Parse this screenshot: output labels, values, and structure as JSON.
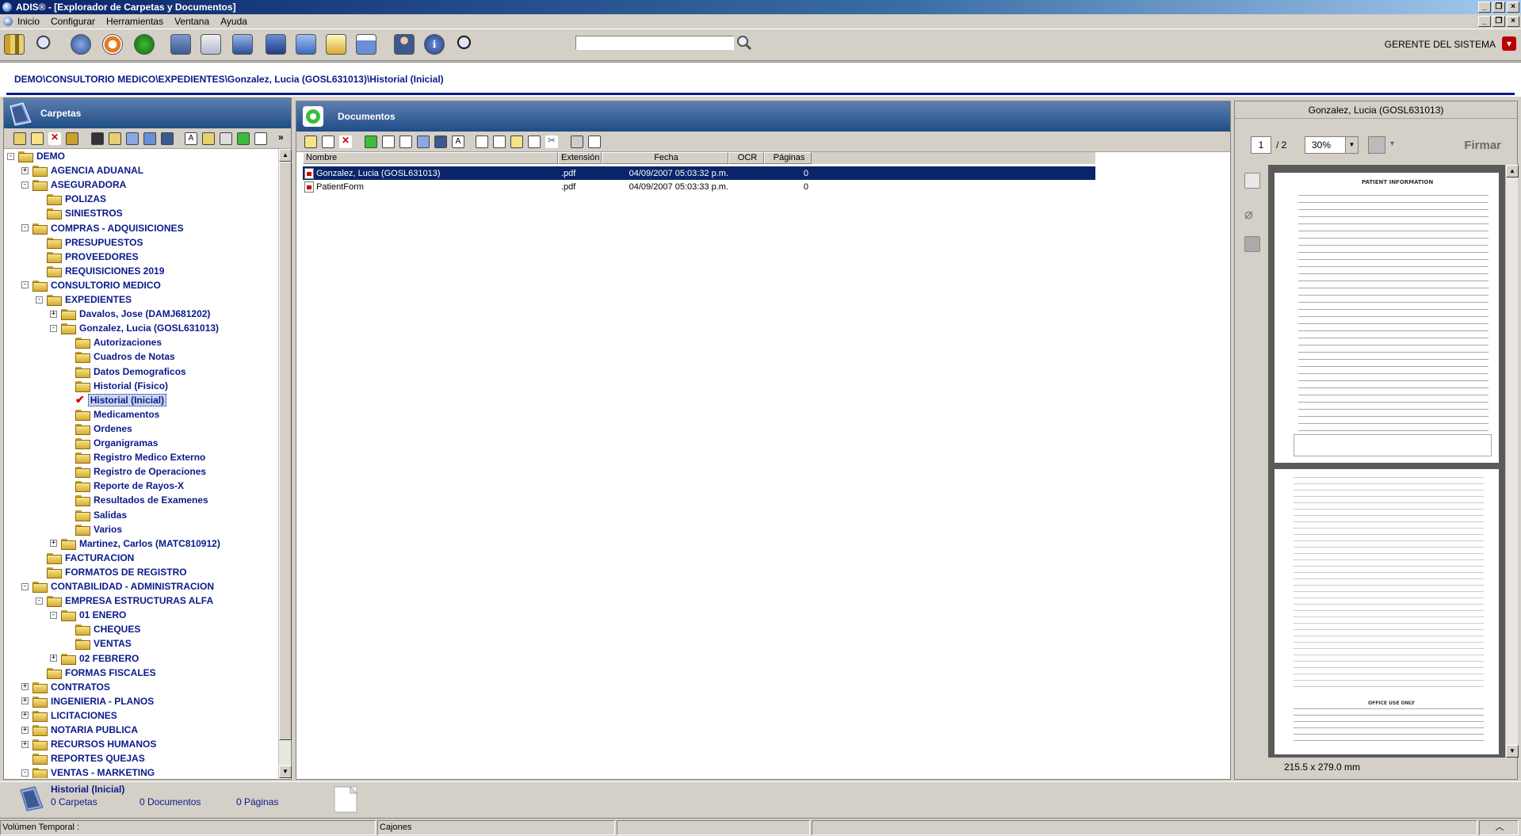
{
  "window": {
    "title": "ADIS® - [Explorador de Carpetas y Documentos]"
  },
  "menu": [
    "Inicio",
    "Configurar",
    "Herramientas",
    "Ventana",
    "Ayuda"
  ],
  "toolbar": {
    "search_value": "",
    "user": "GERENTE DEL SISTEMA"
  },
  "path": "DEMO\\CONSULTORIO MEDICO\\EXPEDIENTES\\Gonzalez, Lucia (GOSL631013)\\Historial (Inicial)",
  "folders_panel": {
    "title": "Carpetas",
    "tree": [
      {
        "label": "DEMO",
        "level": 0,
        "exp": "-"
      },
      {
        "label": "AGENCIA ADUANAL",
        "level": 1,
        "exp": "+"
      },
      {
        "label": "ASEGURADORA",
        "level": 1,
        "exp": "-"
      },
      {
        "label": "POLIZAS",
        "level": 2,
        "exp": ""
      },
      {
        "label": "SINIESTROS",
        "level": 2,
        "exp": ""
      },
      {
        "label": "COMPRAS - ADQUISICIONES",
        "level": 1,
        "exp": "-"
      },
      {
        "label": "PRESUPUESTOS",
        "level": 2,
        "exp": ""
      },
      {
        "label": "PROVEEDORES",
        "level": 2,
        "exp": ""
      },
      {
        "label": "REQUISICIONES 2019",
        "level": 2,
        "exp": ""
      },
      {
        "label": "CONSULTORIO MEDICO",
        "level": 1,
        "exp": "-"
      },
      {
        "label": "EXPEDIENTES",
        "level": 2,
        "exp": "-"
      },
      {
        "label": "Davalos, Jose (DAMJ681202)",
        "level": 3,
        "exp": "+"
      },
      {
        "label": "Gonzalez, Lucia (GOSL631013)",
        "level": 3,
        "exp": "-"
      },
      {
        "label": "Autorizaciones",
        "level": 4,
        "exp": ""
      },
      {
        "label": "Cuadros de Notas",
        "level": 4,
        "exp": ""
      },
      {
        "label": "Datos Demograficos",
        "level": 4,
        "exp": ""
      },
      {
        "label": "Historial (Fisico)",
        "level": 4,
        "exp": ""
      },
      {
        "label": "Historial (Inicial)",
        "level": 4,
        "exp": "",
        "selected": true
      },
      {
        "label": "Medicamentos",
        "level": 4,
        "exp": ""
      },
      {
        "label": "Ordenes",
        "level": 4,
        "exp": ""
      },
      {
        "label": "Organigramas",
        "level": 4,
        "exp": ""
      },
      {
        "label": "Registro Medico Externo",
        "level": 4,
        "exp": ""
      },
      {
        "label": "Registro de Operaciones",
        "level": 4,
        "exp": ""
      },
      {
        "label": "Reporte de Rayos-X",
        "level": 4,
        "exp": ""
      },
      {
        "label": "Resultados de Examenes",
        "level": 4,
        "exp": ""
      },
      {
        "label": "Salidas",
        "level": 4,
        "exp": ""
      },
      {
        "label": "Varios",
        "level": 4,
        "exp": ""
      },
      {
        "label": "Martinez, Carlos (MATC810912)",
        "level": 3,
        "exp": "+"
      },
      {
        "label": "FACTURACION",
        "level": 2,
        "exp": ""
      },
      {
        "label": "FORMATOS DE REGISTRO",
        "level": 2,
        "exp": ""
      },
      {
        "label": "CONTABILIDAD - ADMINISTRACION",
        "level": 1,
        "exp": "-"
      },
      {
        "label": "EMPRESA ESTRUCTURAS ALFA",
        "level": 2,
        "exp": "-"
      },
      {
        "label": "01 ENERO",
        "level": 3,
        "exp": "-"
      },
      {
        "label": "CHEQUES",
        "level": 4,
        "exp": ""
      },
      {
        "label": "VENTAS",
        "level": 4,
        "exp": ""
      },
      {
        "label": "02 FEBRERO",
        "level": 3,
        "exp": "+"
      },
      {
        "label": "FORMAS FISCALES",
        "level": 2,
        "exp": ""
      },
      {
        "label": "CONTRATOS",
        "level": 1,
        "exp": "+"
      },
      {
        "label": "INGENIERIA - PLANOS",
        "level": 1,
        "exp": "+"
      },
      {
        "label": "LICITACIONES",
        "level": 1,
        "exp": "+"
      },
      {
        "label": "NOTARIA PUBLICA",
        "level": 1,
        "exp": "+"
      },
      {
        "label": "RECURSOS HUMANOS",
        "level": 1,
        "exp": "+"
      },
      {
        "label": "REPORTES QUEJAS",
        "level": 1,
        "exp": ""
      },
      {
        "label": "VENTAS - MARKETING",
        "level": 1,
        "exp": "-"
      }
    ]
  },
  "documents_panel": {
    "title": "Documentos",
    "columns": [
      "Nombre",
      "Extensión",
      "Fecha",
      "OCR",
      "Páginas"
    ],
    "rows": [
      {
        "name": "Gonzalez, Lucia (GOSL631013)",
        "ext": ".pdf",
        "date": "04/09/2007 05:03:32 p.m.",
        "ocr": "",
        "pages": "0",
        "selected": true
      },
      {
        "name": "PatientForm",
        "ext": ".pdf",
        "date": "04/09/2007 05:03:33 p.m.",
        "ocr": "",
        "pages": "0",
        "selected": false
      }
    ]
  },
  "preview": {
    "title": "Gonzalez, Lucia (GOSL631013)",
    "page": "1",
    "page_total": "/ 2",
    "zoom": "30%",
    "sign_label": "Firmar",
    "page_size": "215.5 x 279.0 mm",
    "page1_heading": "PATIENT INFORMATION",
    "page2_heading": "OFFICE USE ONLY"
  },
  "info": {
    "title": "Historial (Inicial)",
    "folders": "0 Carpetas",
    "documents": "0 Documentos",
    "pages": "0 Páginas"
  },
  "status": {
    "volume": "Volúmen Temporal :",
    "drawers": "Cajones"
  }
}
